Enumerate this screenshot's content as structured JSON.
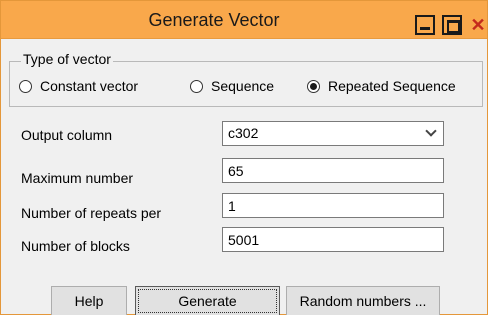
{
  "window": {
    "title": "Generate Vector",
    "close_glyph": "✕"
  },
  "type_group": {
    "legend": "Type of vector",
    "options": [
      {
        "label": "Constant vector",
        "selected": false
      },
      {
        "label": "Sequence",
        "selected": false
      },
      {
        "label": "Repeated Sequence",
        "selected": true
      }
    ]
  },
  "fields": {
    "output_column": {
      "label": "Output column",
      "value": "c302"
    },
    "maximum_number": {
      "label": "Maximum number",
      "value": "65"
    },
    "repeats_per": {
      "label": "Number of repeats per",
      "value": "1"
    },
    "blocks": {
      "label": "Number of blocks",
      "value": "5001"
    }
  },
  "buttons": {
    "help": "Help",
    "generate": "Generate",
    "random": "Random numbers ..."
  },
  "colors": {
    "titlebar": "#f9a84b",
    "close": "#c42b1c",
    "dialog_bg": "#f0f0f0"
  }
}
